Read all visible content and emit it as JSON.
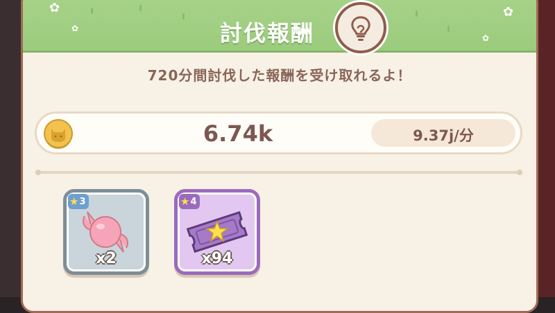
{
  "dialog": {
    "title": "討伐報酬",
    "badge_icon": "idea-lightbulb-icon",
    "message": "720分間討伐した報酬を受け取れるよ！"
  },
  "reward_summary": {
    "currency_icon": "cat-coin-icon",
    "amount": "6.74k",
    "rate": "9.37j/分"
  },
  "items": [
    {
      "icon": "candy-icon",
      "rarity": "3",
      "quantity": "x2",
      "frame_color": "#7d8e98"
    },
    {
      "icon": "star-ticket-icon",
      "rarity": "4",
      "quantity": "x94",
      "frame_color": "#9a6bbd"
    }
  ],
  "colors": {
    "header_green": "#a8d38a",
    "panel_cream": "#f7f1e6",
    "text_brown": "#7d5750",
    "border_brown": "#a06a55"
  }
}
